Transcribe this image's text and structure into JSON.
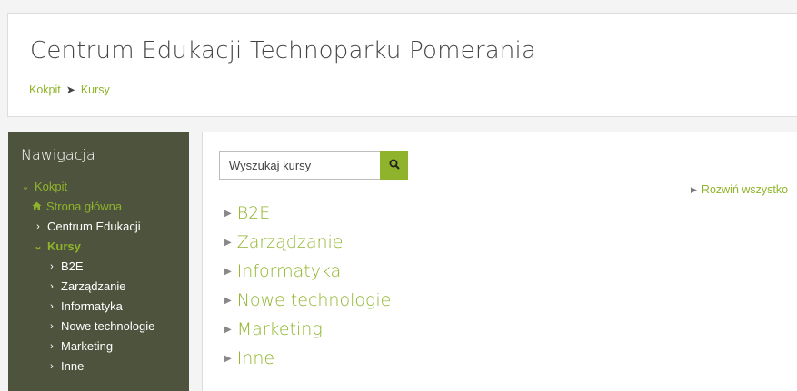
{
  "header": {
    "title": "Centrum Edukacji Technoparku Pomerania",
    "breadcrumb": [
      {
        "label": "Kokpit"
      },
      {
        "label": "Kursy"
      }
    ],
    "breadcrumb_separator": "➤"
  },
  "navigation": {
    "title": "Nawigacja",
    "items": [
      {
        "label": "Kokpit",
        "icon": "chevron-down-icon",
        "icon_glyph": "⌄"
      },
      {
        "label": "Strona główna",
        "icon": "home-icon"
      },
      {
        "label": "Centrum Edukacji",
        "icon": "chevron-right-icon",
        "icon_glyph": "›"
      },
      {
        "label": "Kursy",
        "icon": "chevron-down-icon",
        "icon_glyph": "⌄"
      },
      {
        "label": "B2E",
        "icon": "chevron-right-icon",
        "icon_glyph": "›"
      },
      {
        "label": "Zarządzanie",
        "icon": "chevron-right-icon",
        "icon_glyph": "›"
      },
      {
        "label": "Informatyka",
        "icon": "chevron-right-icon",
        "icon_glyph": "›"
      },
      {
        "label": "Nowe technologie",
        "icon": "chevron-right-icon",
        "icon_glyph": "›"
      },
      {
        "label": "Marketing",
        "icon": "chevron-right-icon",
        "icon_glyph": "›"
      },
      {
        "label": "Inne",
        "icon": "chevron-right-icon",
        "icon_glyph": "›"
      }
    ]
  },
  "main": {
    "search": {
      "placeholder": "Wyszukaj kursy",
      "value": "",
      "icon": "search-icon"
    },
    "expand_all": "Rozwiń wszystko",
    "expand_icon": "▶",
    "category_icon": "▶",
    "categories": [
      {
        "label": "B2E"
      },
      {
        "label": "Zarządzanie"
      },
      {
        "label": "Informatyka"
      },
      {
        "label": "Nowe technologie"
      },
      {
        "label": "Marketing"
      },
      {
        "label": "Inne"
      }
    ]
  },
  "colors": {
    "accent": "#8fb42b",
    "nav_background": "#4e533e",
    "text": "#444444"
  }
}
